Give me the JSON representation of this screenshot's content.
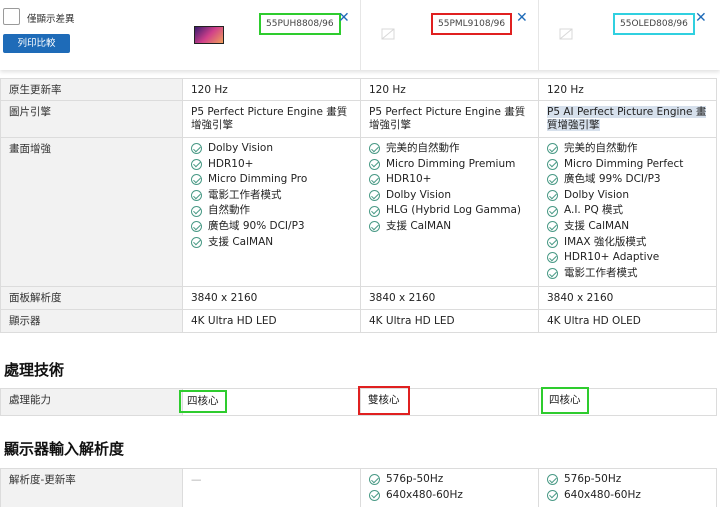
{
  "header": {
    "diff_label": "僅顯示差異",
    "print_button": "列印比較",
    "products": [
      {
        "model": "55PUH8808/96",
        "close": "✕"
      },
      {
        "model": "55PML9108/96",
        "close": "✕"
      },
      {
        "model": "55OLED808/96",
        "close": "✕"
      }
    ]
  },
  "table1": {
    "rows": [
      {
        "label": "原生更新率",
        "values": [
          "120 Hz",
          "120 Hz",
          "120 Hz"
        ]
      },
      {
        "label": "圖片引擎",
        "values": [
          "P5 Perfect Picture Engine 畫質增強引擎",
          "P5 Perfect Picture Engine 畫質增強引擎",
          "P5 AI Perfect Picture Engine 畫質增強引擎"
        ]
      },
      {
        "label": "畫面增強"
      },
      {
        "label": "面板解析度",
        "values": [
          "3840 x 2160",
          "3840 x 2160",
          "3840 x 2160"
        ]
      },
      {
        "label": "顯示器",
        "values": [
          "4K Ultra HD LED",
          "4K Ultra HD LED",
          "4K Ultra HD OLED"
        ]
      }
    ],
    "enhancements": [
      [
        "Dolby Vision",
        "HDR10+",
        "Micro Dimming Pro",
        "電影工作者模式",
        "自然動作",
        "廣色域 90% DCI/P3",
        "支援 CalMAN"
      ],
      [
        "完美的自然動作",
        "Micro Dimming Premium",
        "HDR10+",
        "Dolby Vision",
        "HLG (Hybrid Log Gamma)",
        "支援 CalMAN"
      ],
      [
        "完美的自然動作",
        "Micro Dimming Perfect",
        "廣色域 99% DCI/P3",
        "Dolby Vision",
        "A.I. PQ 模式",
        "支援 CalMAN",
        "IMAX 強化版模式",
        "HDR10+ Adaptive",
        "電影工作者模式"
      ]
    ]
  },
  "section_processing": {
    "title": "處理技術",
    "label": "處理能力",
    "values": [
      "四核心",
      "雙核心",
      "四核心"
    ]
  },
  "section_resolution": {
    "title": "顯示器輸入解析度",
    "label": "解析度-更新率",
    "empty": "—",
    "values": [
      [
        "576p-50Hz",
        "640x480-60Hz"
      ],
      [
        "576p-50Hz",
        "640x480-60Hz"
      ]
    ]
  }
}
